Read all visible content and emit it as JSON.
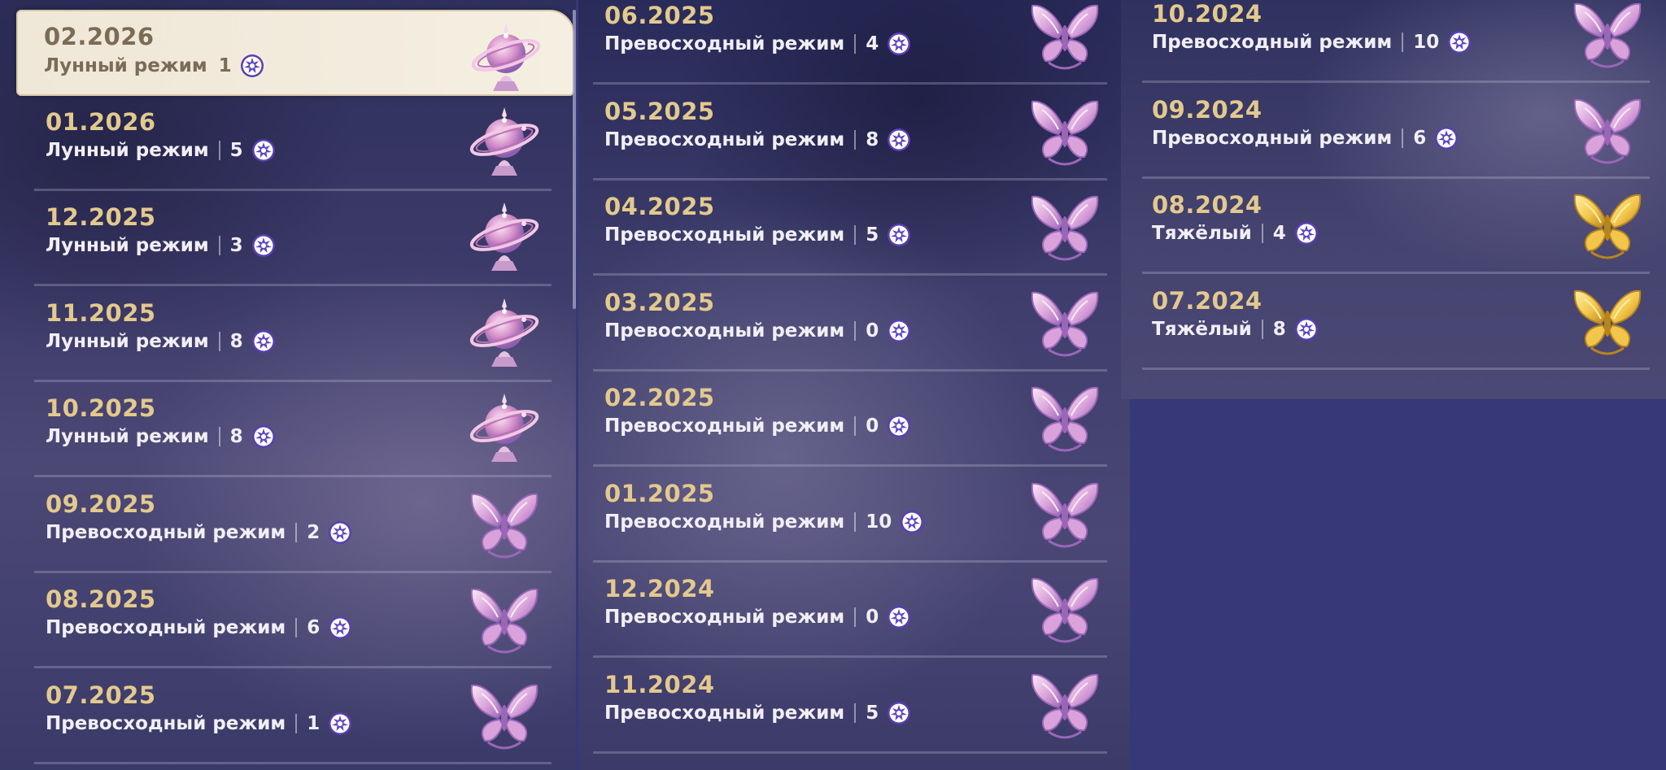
{
  "star_icon": "abyss-star-icon",
  "colors": {
    "date": "#e3c98d",
    "mode": "#f1eef5",
    "selected_bg": "#efe7d7",
    "page_bg": "#363877"
  },
  "columns": [
    {
      "entries": [
        {
          "date": "02.2026",
          "mode": "Лунный режим",
          "count": "1",
          "emblem": "lunar-orb",
          "selected": true
        },
        {
          "date": "01.2026",
          "mode": "Лунный режим",
          "count": "5",
          "emblem": "lunar-orb"
        },
        {
          "date": "12.2025",
          "mode": "Лунный режим",
          "count": "3",
          "emblem": "lunar-orb"
        },
        {
          "date": "11.2025",
          "mode": "Лунный режим",
          "count": "8",
          "emblem": "lunar-orb"
        },
        {
          "date": "10.2025",
          "mode": "Лунный режим",
          "count": "8",
          "emblem": "lunar-orb"
        },
        {
          "date": "09.2025",
          "mode": "Превосходный режим",
          "count": "2",
          "emblem": "pink-butterfly"
        },
        {
          "date": "08.2025",
          "mode": "Превосходный режим",
          "count": "6",
          "emblem": "pink-butterfly"
        },
        {
          "date": "07.2025",
          "mode": "Превосходный режим",
          "count": "1",
          "emblem": "pink-butterfly"
        }
      ]
    },
    {
      "entries": [
        {
          "date": "06.2025",
          "mode": "Превосходный режим",
          "count": "4",
          "emblem": "pink-butterfly"
        },
        {
          "date": "05.2025",
          "mode": "Превосходный режим",
          "count": "8",
          "emblem": "pink-butterfly"
        },
        {
          "date": "04.2025",
          "mode": "Превосходный режим",
          "count": "5",
          "emblem": "pink-butterfly"
        },
        {
          "date": "03.2025",
          "mode": "Превосходный режим",
          "count": "0",
          "emblem": "pink-butterfly"
        },
        {
          "date": "02.2025",
          "mode": "Превосходный режим",
          "count": "0",
          "emblem": "pink-butterfly"
        },
        {
          "date": "01.2025",
          "mode": "Превосходный режим",
          "count": "10",
          "emblem": "pink-butterfly"
        },
        {
          "date": "12.2024",
          "mode": "Превосходный режим",
          "count": "0",
          "emblem": "pink-butterfly"
        },
        {
          "date": "11.2024",
          "mode": "Превосходный режим",
          "count": "5",
          "emblem": "pink-butterfly"
        }
      ]
    },
    {
      "entries": [
        {
          "date": "10.2024",
          "mode": "Превосходный режим",
          "count": "10",
          "emblem": "pink-butterfly"
        },
        {
          "date": "09.2024",
          "mode": "Превосходный режим",
          "count": "6",
          "emblem": "pink-butterfly"
        },
        {
          "date": "08.2024",
          "mode": "Тяжёлый",
          "count": "4",
          "emblem": "gold-butterfly"
        },
        {
          "date": "07.2024",
          "mode": "Тяжёлый",
          "count": "8",
          "emblem": "gold-butterfly"
        }
      ]
    }
  ]
}
